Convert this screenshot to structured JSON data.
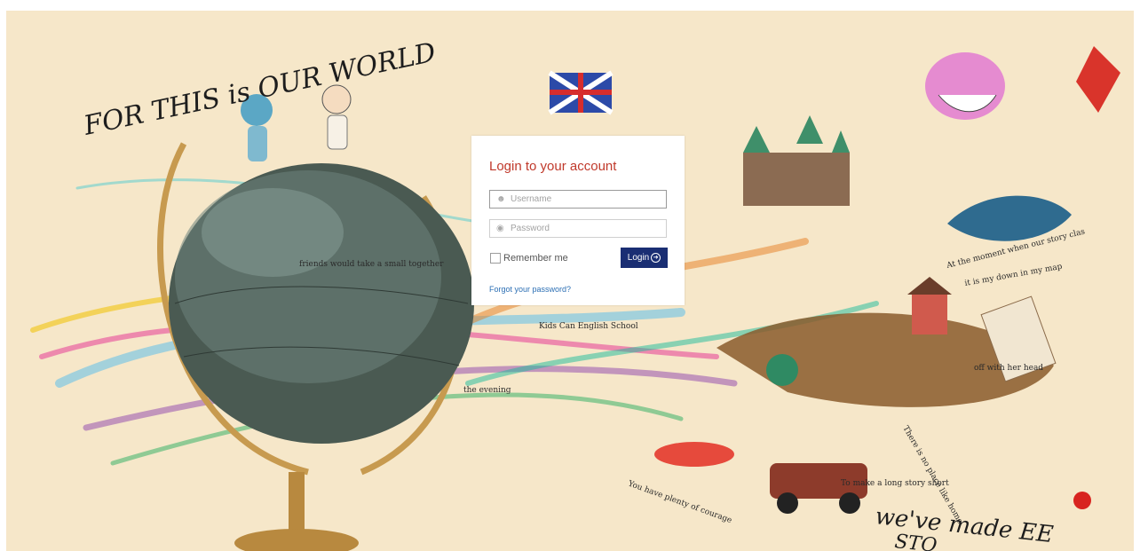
{
  "background": {
    "headline": "FOR THIS is OUR WORLD",
    "footer_handwriting": "we've made EE",
    "footer_handwriting_2": "STO",
    "school_name": "Kids Can English School",
    "book_phrases": [
      "At the moment when our story clas",
      "off with her head",
      "the evening",
      "friends would take a small together",
      "it is my down in my map",
      "There is no place like home.",
      "To make a long story short",
      "You have plenty of courage"
    ],
    "colors": {
      "parchment": "#f6e7c9",
      "globe": "#4a5a52",
      "accent_red": "#c0392b",
      "button_blue": "#1a2e73"
    }
  },
  "login": {
    "title": "Login to your account",
    "username_placeholder": "Username",
    "username_icon": "user-icon",
    "password_placeholder": "Password",
    "password_icon": "lock-icon",
    "remember_label": "Remember me",
    "login_label": "Login",
    "login_icon": "arrow-circle-right-icon",
    "forgot_label": "Forgot your password?"
  }
}
